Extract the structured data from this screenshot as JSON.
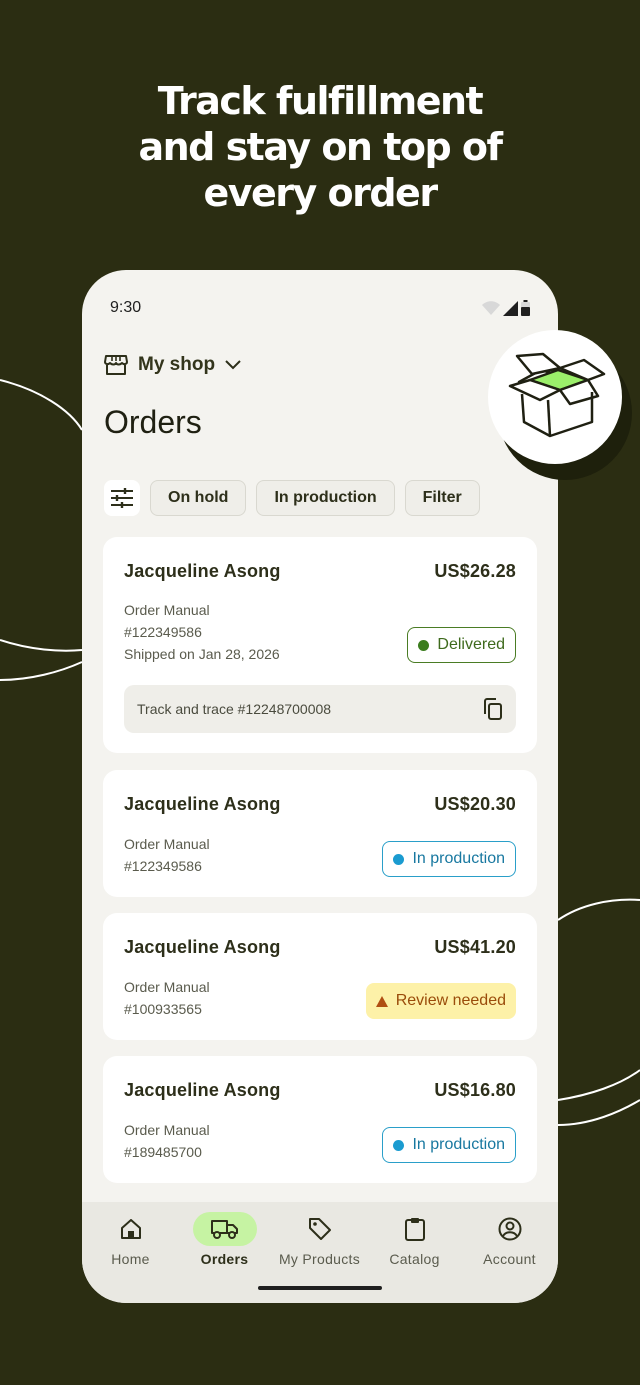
{
  "headline": [
    "Track fulfillment",
    "and stay on top of",
    "every order"
  ],
  "status_bar": {
    "time": "9:30"
  },
  "shop": {
    "name": "My shop"
  },
  "page": {
    "title": "Orders"
  },
  "filters": [
    "On hold",
    "In production",
    "Filter"
  ],
  "orders": [
    {
      "name": "Jacqueline Asong",
      "price": "US$26.28",
      "source": "Order Manual",
      "number": "#122349586",
      "shipped": "Shipped on Jan 28, 2026",
      "status": "Delivered",
      "track": "Track and trace #12248700008"
    },
    {
      "name": "Jacqueline Asong",
      "price": "US$20.30",
      "source": "Order Manual",
      "number": "#122349586",
      "status": "In production"
    },
    {
      "name": "Jacqueline Asong",
      "price": "US$41.20",
      "source": "Order Manual",
      "number": "#100933565",
      "status": "Review needed"
    },
    {
      "name": "Jacqueline Asong",
      "price": "US$16.80",
      "source": "Order Manual",
      "number": "#189485700",
      "status": "In production"
    }
  ],
  "nav": [
    {
      "label": "Home",
      "icon": "home-icon"
    },
    {
      "label": "Orders",
      "icon": "truck-icon",
      "active": true
    },
    {
      "label": "My Products",
      "icon": "tag-icon"
    },
    {
      "label": "Catalog",
      "icon": "clipboard-icon"
    },
    {
      "label": "Account",
      "icon": "account-icon"
    }
  ],
  "colors": {
    "background": "#2b2d12",
    "nav_active": "#c6f3a3",
    "delivered": "#3b7d1e",
    "in_production": "#1a9bd0",
    "review_needed": "#fdf1a8"
  }
}
